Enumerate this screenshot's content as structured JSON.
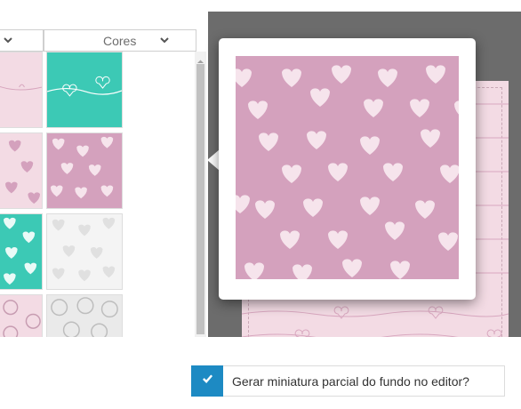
{
  "filters": {
    "left": {
      "label": ""
    },
    "right": {
      "label": "Cores"
    }
  },
  "thumbnails": [
    {
      "pattern": "pink-wave",
      "bg": "#f3dbe4"
    },
    {
      "pattern": "teal-hearts-wave",
      "bg": "#3cc9b5"
    },
    {
      "pattern": "small-pink-hearts-light",
      "bg": "#f3dbe4"
    },
    {
      "pattern": "pink-hearts",
      "bg": "#d4a1bd"
    },
    {
      "pattern": "teal-white-hearts",
      "bg": "#3cc9b5"
    },
    {
      "pattern": "grey-hearts",
      "bg": "#f1f1f1"
    },
    {
      "pattern": "pink-swirls",
      "bg": "#f3dbe4"
    },
    {
      "pattern": "grey-swirls",
      "bg": "#eaeaea"
    }
  ],
  "preview": {
    "pattern": "pink-hearts",
    "bg": "#d4a1bd",
    "heart_color": "#f6e4ec"
  },
  "canvas": {
    "bg": "#6c6c6c",
    "paper_bg": "#f3dbe4"
  },
  "option": {
    "label": "Gerar miniatura parcial do fundo no editor?",
    "checked": true,
    "color": "#1d8ac3"
  },
  "icons": {
    "filter_chevron": "chevron-down-icon",
    "scroll_up": "arrow-up-icon",
    "check": "check-icon"
  }
}
